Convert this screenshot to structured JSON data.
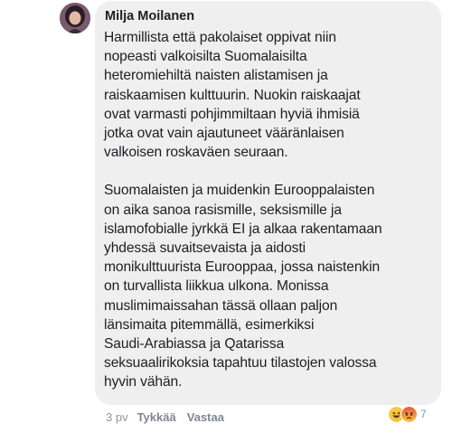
{
  "comment": {
    "author": "Milja Moilanen",
    "paragraphs": [
      "Harmillista että pakolaiset oppivat niin\nnopeasti valkoisilta Suomalaisilta\nheteromiehiltä naisten alistamisen ja\nraiskaamisen kulttuurin. Nuokin raiskaajat\novat varmasti pohjimmiltaan hyviä ihmisiä\njotka ovat vain ajautuneet vääränlaisen\nvalkoisen roskaväen seuraan.",
      "Suomalaisten ja muidenkin Eurooppalaisten\non aika sanoa rasismille, seksismille ja\nislamofobialle jyrkkä EI ja alkaa rakentamaan\nyhdessä suvaitsevaista ja aidosti\nmonikulttuurista Eurooppaa, jossa naistenkin\non turvallista liikkua ulkona. Monissa\nmuslimimaissahan tässä ollaan paljon\nlänsimaita pitemmällä, esimerkiksi\nSaudi-Arabiassa ja Qatarissa\nseksuaalirikoksia tapahtuu tilastojen valossa\nhyvin vähän."
    ],
    "timestamp": "3 pv",
    "like_label": "Tykkää",
    "reply_label": "Vastaa",
    "reactions": {
      "icons": [
        "haha-reaction-icon",
        "angry-reaction-icon"
      ],
      "count": "7"
    }
  },
  "colors": {
    "bubble_bg": "#efefef",
    "text": "#1c1e21",
    "meta": "#8d949e"
  }
}
